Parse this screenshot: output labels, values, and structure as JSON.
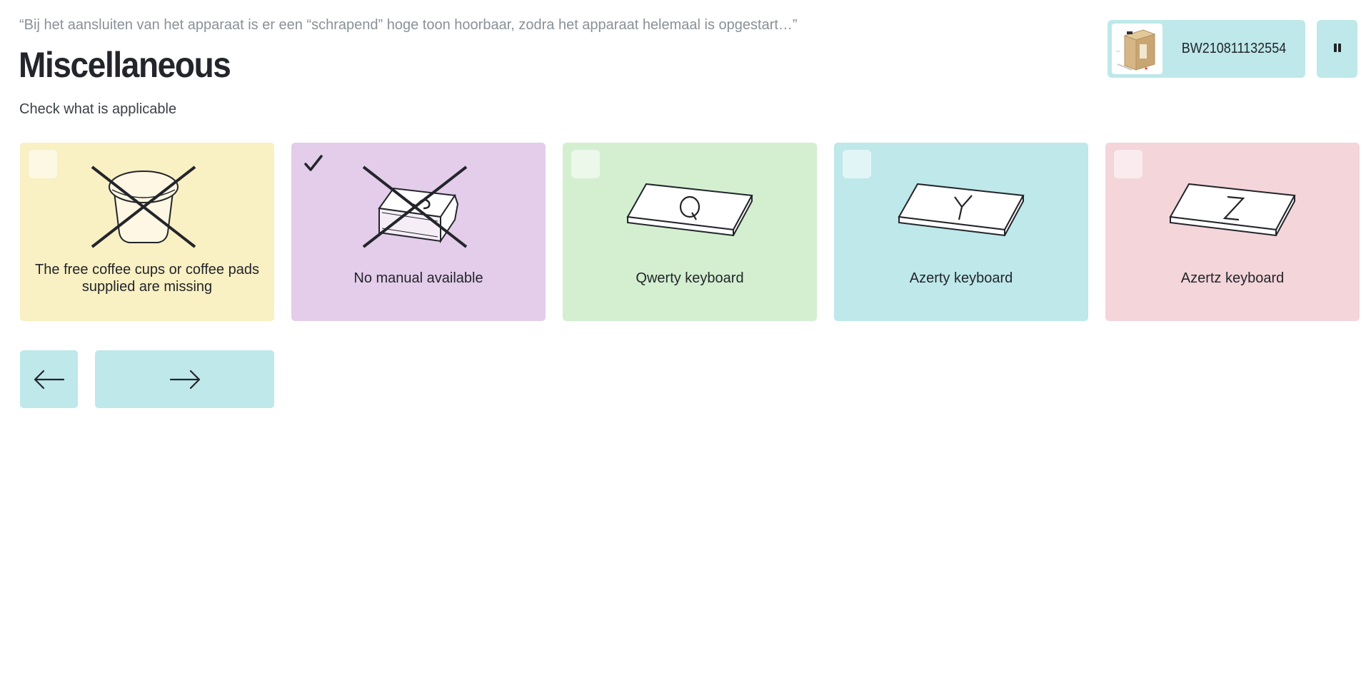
{
  "header": {
    "quote": "“Bij het aansluiten van het apparaat is er een “schrapend” hoge toon hoorbaar, zodra het apparaat helemaal is opgestart…”",
    "title": "Miscellaneous",
    "subtitle": "Check what is applicable"
  },
  "product": {
    "id": "BW210811132554",
    "thumbnail_icon": "product-box-image"
  },
  "controls": {
    "pause_icon": "pause-icon",
    "back_icon": "arrow-left-icon",
    "next_icon": "arrow-right-icon"
  },
  "options": [
    {
      "label": "The free coffee cups or coffee pads supplied are missing",
      "checked": false,
      "color": "#f9f0c3",
      "icon": "coffee-cup-crossed-icon"
    },
    {
      "label": "No manual available",
      "checked": true,
      "color": "#e3cdea",
      "icon": "manual-crossed-icon"
    },
    {
      "label": "Qwerty keyboard",
      "checked": false,
      "color": "#d3efd0",
      "icon": "keyboard-q-icon",
      "key": "Q"
    },
    {
      "label": "Azerty keyboard",
      "checked": false,
      "color": "#bee8ea",
      "icon": "keyboard-y-icon",
      "key": "Y"
    },
    {
      "label": "Azertz keyboard",
      "checked": false,
      "color": "#f3d5da",
      "icon": "keyboard-z-icon",
      "key": "Z"
    }
  ]
}
